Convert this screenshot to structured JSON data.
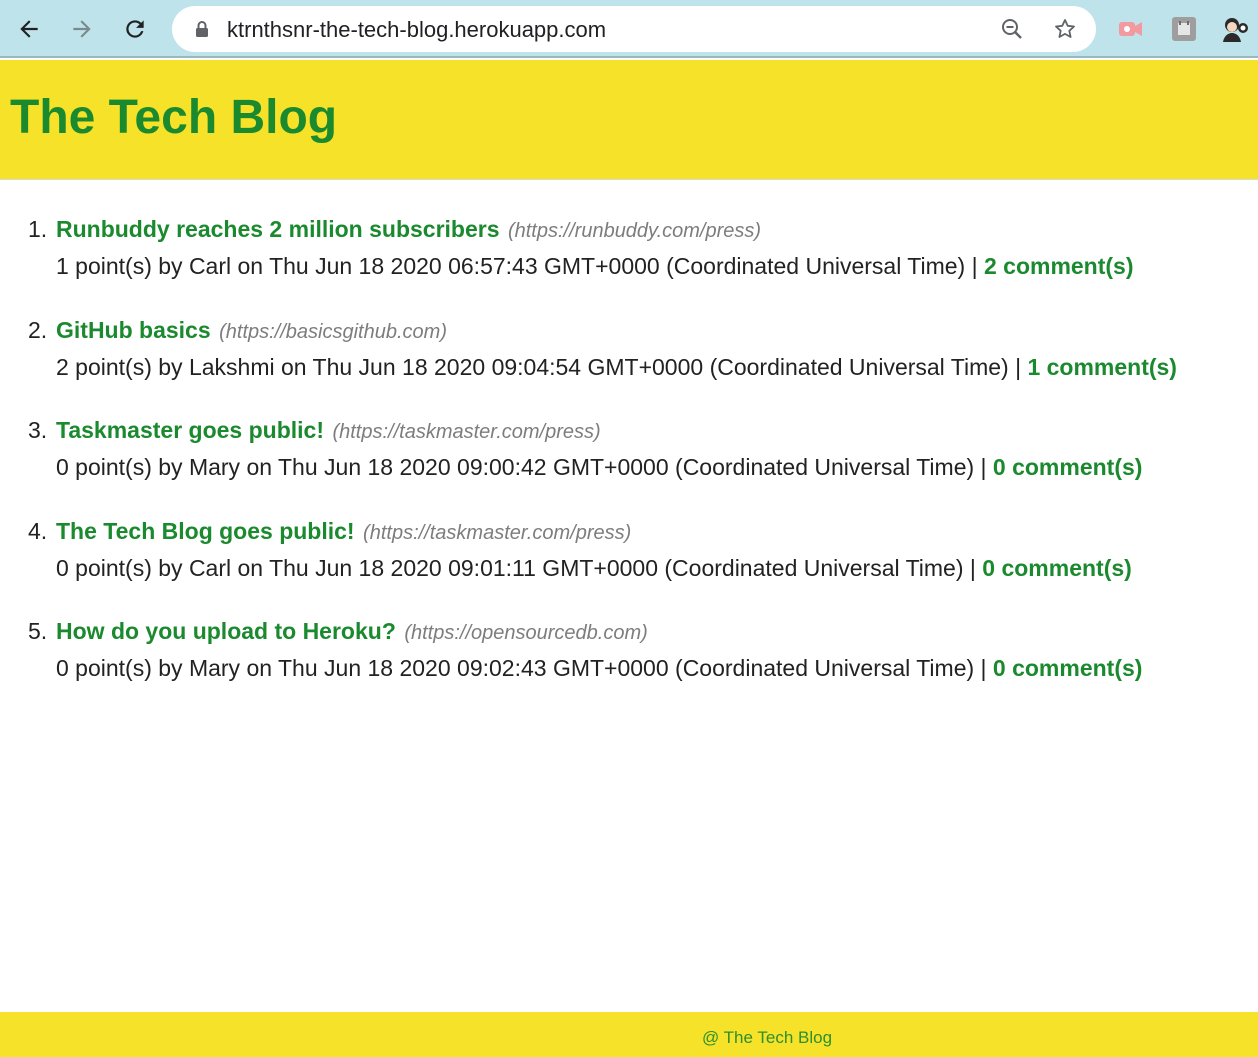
{
  "browser": {
    "url": "ktrnthsnr-the-tech-blog.herokuapp.com"
  },
  "header": {
    "title": "The Tech Blog"
  },
  "posts": [
    {
      "number": "1.",
      "title": "Runbuddy reaches 2 million subscribers",
      "url": "(https://runbuddy.com/press)",
      "meta": "1 point(s) by Carl on Thu Jun 18 2020 06:57:43 GMT+0000 (Coordinated Universal Time) |",
      "comments": "2 comment(s)"
    },
    {
      "number": "2.",
      "title": "GitHub basics",
      "url": "(https://basicsgithub.com)",
      "meta": "2 point(s) by Lakshmi on Thu Jun 18 2020 09:04:54 GMT+0000 (Coordinated Universal Time) |",
      "comments": "1 comment(s)"
    },
    {
      "number": "3.",
      "title": "Taskmaster goes public!",
      "url": "(https://taskmaster.com/press)",
      "meta": "0 point(s) by Mary on Thu Jun 18 2020 09:00:42 GMT+0000 (Coordinated Universal Time) |",
      "comments": "0 comment(s)"
    },
    {
      "number": "4.",
      "title": "The Tech Blog goes public!",
      "url": "(https://taskmaster.com/press)",
      "meta": "0 point(s) by Carl on Thu Jun 18 2020 09:01:11 GMT+0000 (Coordinated Universal Time) |",
      "comments": "0 comment(s)"
    },
    {
      "number": "5.",
      "title": "How do you upload to Heroku?",
      "url": "(https://opensourcedb.com)",
      "meta": "0 point(s) by Mary on Thu Jun 18 2020 09:02:43 GMT+0000 (Coordinated Universal Time) |",
      "comments": "0 comment(s)"
    }
  ],
  "footer": {
    "text": "@ The Tech Blog"
  },
  "colors": {
    "brand_yellow": "#f5e229",
    "brand_green": "#1b8a2f",
    "chrome_bg": "#bfe3ea"
  },
  "icons": [
    "back-arrow-icon",
    "forward-arrow-icon",
    "reload-icon",
    "lock-icon",
    "zoom-icon",
    "star-icon",
    "extension-icon",
    "profile-avatar-icon"
  ]
}
